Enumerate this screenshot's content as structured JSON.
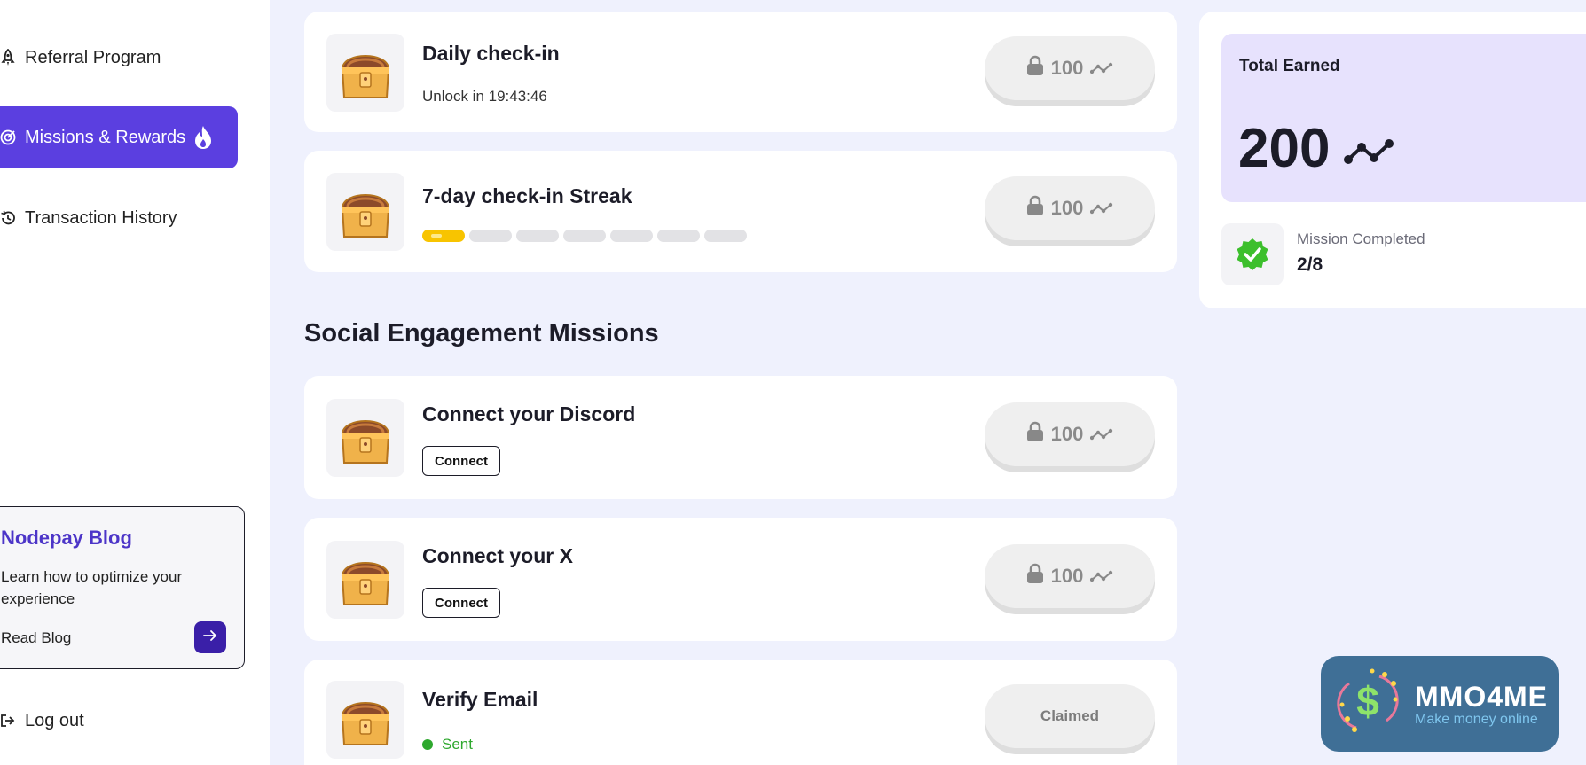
{
  "sidebar": {
    "items": [
      {
        "label": "Referral Program",
        "icon": "rocket-icon"
      },
      {
        "label": "Missions & Rewards",
        "icon": "target-icon",
        "active": true
      },
      {
        "label": "Transaction History",
        "icon": "history-icon"
      }
    ],
    "blog": {
      "title": "Nodepay Blog",
      "description": "Learn how to optimize your experience",
      "link_label": "Read Blog"
    },
    "logout_label": "Log out"
  },
  "missions": [
    {
      "title": "Daily check-in",
      "subtitle": "Unlock in 19:43:46",
      "reward": "100",
      "state": "locked"
    },
    {
      "title": "7-day check-in Streak",
      "streak_total": 7,
      "streak_done": 1,
      "reward": "100",
      "state": "locked"
    }
  ],
  "social_section": {
    "title": "Social Engagement Missions",
    "missions": [
      {
        "title": "Connect your Discord",
        "action_label": "Connect",
        "reward": "100",
        "state": "locked"
      },
      {
        "title": "Connect your X",
        "action_label": "Connect",
        "reward": "100",
        "state": "locked"
      },
      {
        "title": "Verify Email",
        "status": "Sent",
        "reward_label": "Claimed",
        "state": "claimed"
      }
    ]
  },
  "stats": {
    "total_earned_label": "Total Earned",
    "total_earned_value": "200",
    "mission_completed_label": "Mission Completed",
    "mission_completed_value": "2/8"
  },
  "watermark": {
    "brand": "MMO4ME",
    "tagline": "Make money online"
  },
  "colors": {
    "accent": "#5b3fe0",
    "page_bg": "#eff1fd",
    "earned_bg": "#e7e2fd",
    "streak_active": "#f8c400",
    "success": "#2ea82e"
  }
}
